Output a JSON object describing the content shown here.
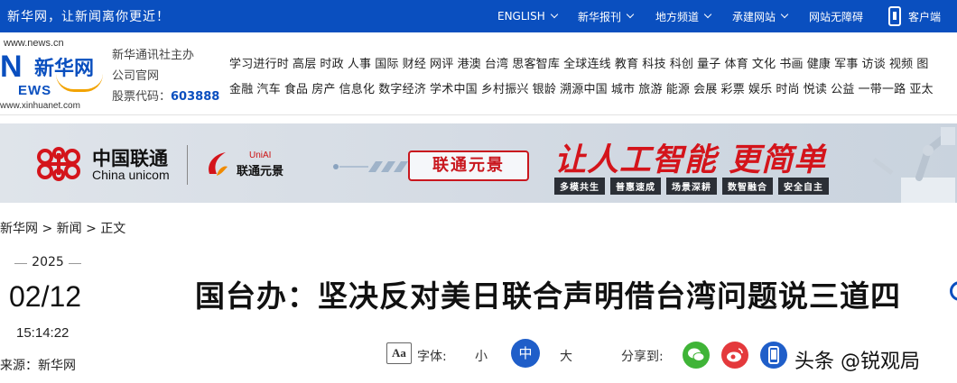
{
  "topbar": {
    "slogan": "新华网，让新闻离你更近！",
    "nav": [
      {
        "label": "ENGLISH",
        "has_dropdown": true
      },
      {
        "label": "新华报刊",
        "has_dropdown": true
      },
      {
        "label": "地方频道",
        "has_dropdown": true
      },
      {
        "label": "承建网站",
        "has_dropdown": true
      },
      {
        "label": "网站无障碍",
        "has_dropdown": false
      },
      {
        "label": "客户端",
        "icon": "mobile-phone-icon"
      }
    ],
    "color": "#0a4fbf"
  },
  "logo": {
    "url_top": "www.news.cn",
    "mark_letter": "N",
    "mark_cn": "新华网",
    "mark_ews": "EWS",
    "url_bottom": "www.xinhuanet.com"
  },
  "org": {
    "line1": "新华通讯社主办",
    "line2": "公司官网",
    "stock_label": "股票代码：",
    "stock_code": "603888"
  },
  "channels": {
    "row1": [
      "学习进行时",
      "高层",
      "时政",
      "人事",
      "国际",
      "财经",
      "网评",
      "港澳",
      "台湾",
      "思客智库",
      "全球连线",
      "教育",
      "科技",
      "科创",
      "量子",
      "体育",
      "文化",
      "书画",
      "健康",
      "军事",
      "访谈",
      "视频",
      "图"
    ],
    "row2": [
      "金融",
      "汽车",
      "食品",
      "房产",
      "信息化",
      "数字经济",
      "学术中国",
      "乡村振兴",
      "银龄",
      "溯源中国",
      "城市",
      "旅游",
      "能源",
      "会展",
      "彩票",
      "娱乐",
      "时尚",
      "悦读",
      "公益",
      "一带一路",
      "亚太"
    ]
  },
  "banner": {
    "brand_cn": "中国联通",
    "brand_en": "China unicom",
    "uniai_small": "UniAI",
    "uniai_name": "联通元景",
    "pill_text": "联通元景",
    "slogan": "让人工智能 更简单",
    "tags": [
      "多模共生",
      "普惠速成",
      "场景深耕",
      "数智融合",
      "安全自主"
    ],
    "accent_color": "#d4141b"
  },
  "breadcrumb": {
    "items": [
      "新华网",
      "新闻",
      "正文"
    ],
    "separator": ">"
  },
  "article": {
    "year": "2025",
    "month_day": "02/12",
    "time": "15:14:22",
    "source_label": "来源：",
    "source": "新华网",
    "title": "国台办：坚决反对美日联合声明借台湾问题说三道四"
  },
  "toolbar": {
    "font_label": "字体:",
    "font_icon_text": "Aa",
    "sizes": [
      "小",
      "中",
      "大"
    ],
    "selected_size": "中",
    "share_label": "分享到:",
    "share_targets": [
      {
        "name": "wechat-icon",
        "color": "#3fb437"
      },
      {
        "name": "weibo-icon",
        "color": "#e4393c"
      },
      {
        "name": "mobile-icon",
        "color": "#1f5ec9"
      }
    ]
  },
  "watermark": "头条 @锐观局"
}
